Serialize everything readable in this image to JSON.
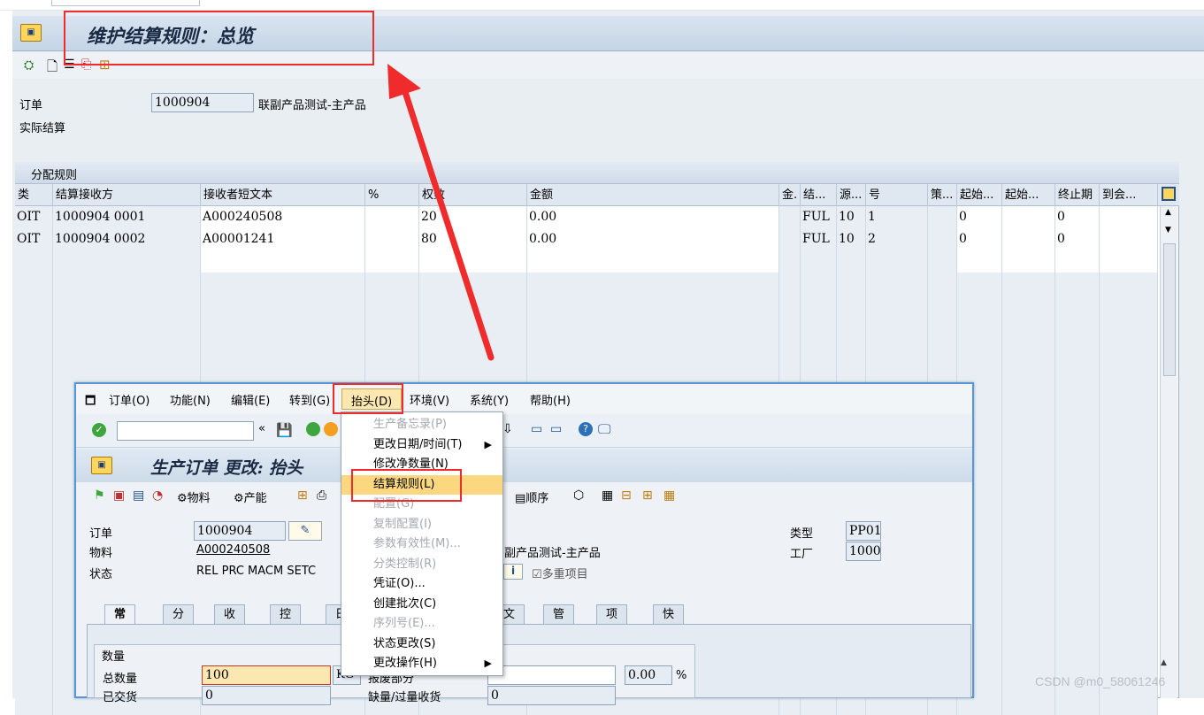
{
  "window": {
    "title": "维护结算规则：总览",
    "icon": "sap-app-icon"
  },
  "header": {
    "order_label": "订单",
    "order_value": "1000904",
    "order_desc": "联副产品测试-主产品",
    "settlement_type": "实际结算"
  },
  "rules_section": {
    "title": "分配规则"
  },
  "table": {
    "columns": [
      "类",
      "结算接收方",
      "接收者短文本",
      "%",
      "权数",
      "金额",
      "金.",
      "结...",
      "源...",
      "号",
      "策...",
      "起始...",
      "起始...",
      "终止期",
      "到会..."
    ],
    "rows": [
      [
        "OIT",
        "1000904 0001",
        "A000240508",
        "",
        "20",
        "0.00",
        "",
        "FUL",
        "10",
        "1",
        "",
        "0",
        "",
        "0",
        ""
      ],
      [
        "OIT",
        "1000904 0002",
        "A00001241",
        "",
        "80",
        "0.00",
        "",
        "FUL",
        "10",
        "2",
        "",
        "0",
        "",
        "0",
        ""
      ]
    ]
  },
  "overlay": {
    "menubar": [
      {
        "label": "订单(O)"
      },
      {
        "label": "功能(N)"
      },
      {
        "label": "编辑(E)"
      },
      {
        "label": "转到(G)"
      },
      {
        "label": "抬头(D)"
      },
      {
        "label": "环境(V)"
      },
      {
        "label": "系统(Y)"
      },
      {
        "label": "帮助(H)"
      }
    ],
    "title": "生产订单 更改: 抬头",
    "toolbar3": {
      "material": "物料",
      "capacity": "产能",
      "sequence": "顺序"
    },
    "fields": {
      "order_label": "订单",
      "order_value": "1000904",
      "material_label": "物料",
      "material_value": "A000240508",
      "material_desc": "副产品测试-主产品",
      "status_label": "状态",
      "status_value": "REL  PRC  MACM SETC",
      "type_label": "类型",
      "type_value": "PP01",
      "plant_label": "工厂",
      "plant_value": "1000",
      "multi_item": "多重项目"
    },
    "tabs": [
      "常规",
      "分配",
      "收货",
      "控制",
      "日",
      "文本",
      "管理",
      "项目",
      "快速录入"
    ],
    "quantity": {
      "group_title": "数量",
      "total_label": "总数量",
      "total_value": "100",
      "unit": "KG",
      "scrap_label": "报废部分",
      "scrap_value": "0.00",
      "scrap_unit": "%",
      "delivered_label": "已交货",
      "delivered_value": "0",
      "short_label": "缺量/过量收货",
      "short_value": "0"
    },
    "dropdown": [
      {
        "label": "生产备忘录(P)",
        "disabled": true
      },
      {
        "label": "更改日期/时间(T)",
        "submenu": true
      },
      {
        "label": "修改净数量(N)"
      },
      {
        "label": "结算规则(L)",
        "highlight": true
      },
      {
        "label": "配置(G)",
        "disabled": true
      },
      {
        "label": "复制配置(I)",
        "disabled": true
      },
      {
        "label": "参数有效性(M)...",
        "disabled": true
      },
      {
        "label": "分类控制(R)",
        "disabled": true
      },
      {
        "label": "凭证(O)..."
      },
      {
        "label": "创建批次(C)"
      },
      {
        "label": "序列号(E)...",
        "disabled": true
      },
      {
        "label": "状态更改(S)"
      },
      {
        "label": "更改操作(H)",
        "submenu": true
      }
    ]
  },
  "watermark": "CSDN @m0_58061246",
  "colors": {
    "annotation_red": "#f02b2b",
    "highlight": "#fbd87f",
    "window_border": "#5a93d6"
  }
}
